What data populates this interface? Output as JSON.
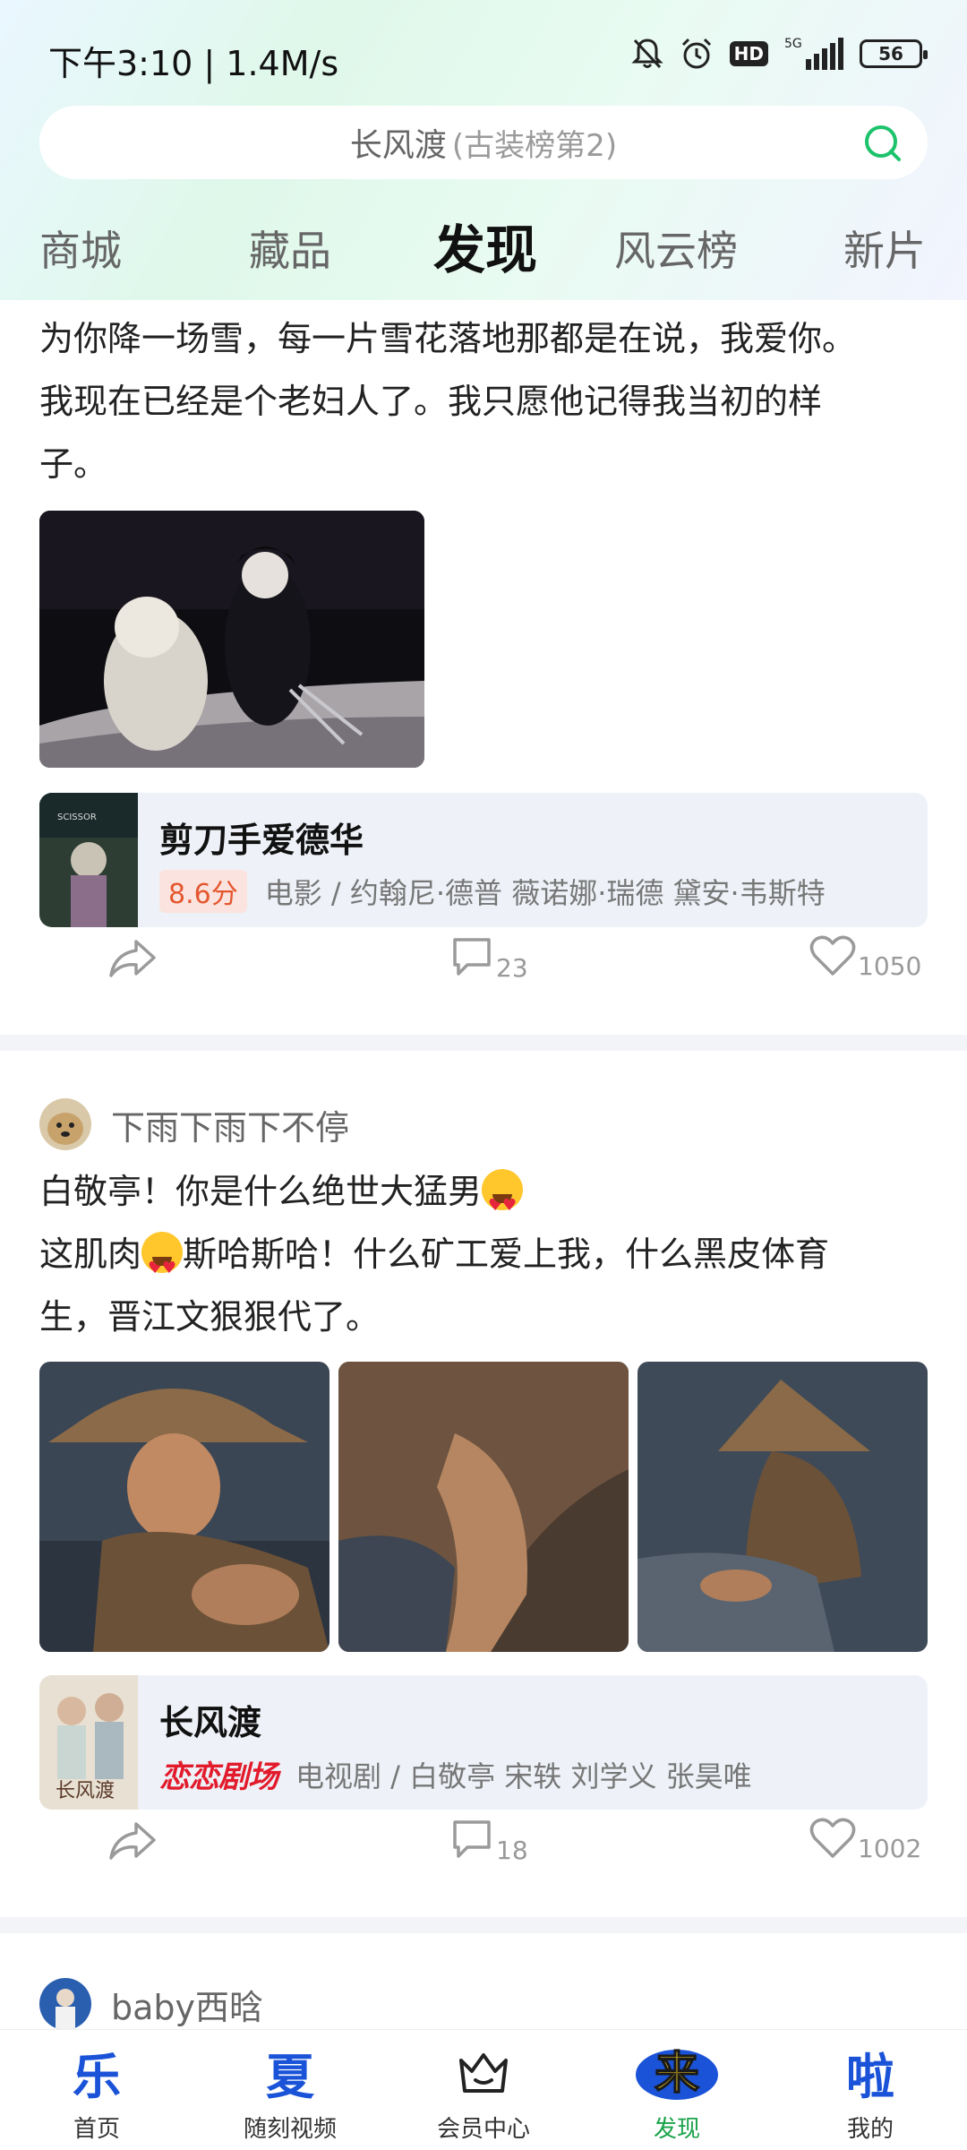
{
  "status": {
    "time": "下午3:10 | 1.4M/s",
    "network": "5G",
    "hd": "HD",
    "battery": "56"
  },
  "search": {
    "title": "长风渡",
    "subtitle": "(古装榜第2)"
  },
  "tabs": [
    {
      "label": "商城"
    },
    {
      "label": "藏品"
    },
    {
      "label": "发现",
      "active": true
    },
    {
      "label": "风云榜"
    },
    {
      "label": "新片"
    }
  ],
  "posts": [
    {
      "text_lines": [
        "为你降一场雪，每一片雪花落地那都是在说，我爱你。",
        "我现在已经是个老妇人了。我只愿他记得我当初的样",
        "子。"
      ],
      "media": {
        "title": "剪刀手爱德华",
        "score": "8.6分",
        "meta": "电影 / 约翰尼·德普 薇诺娜·瑞德 黛安·韦斯特"
      },
      "comments": "23",
      "likes": "1050"
    },
    {
      "user": "下雨下雨下不停",
      "line1": "白敬亭！你是什么绝世大猛男",
      "line2a": "这肌肉",
      "line2b": "斯哈斯哈！什么矿工爱上我，什么黑皮体育",
      "line3": "生，晋江文狠狠代了。",
      "media": {
        "title": "长风渡",
        "brand": "恋恋剧场",
        "meta": "电视剧 / 白敬亭 宋轶 刘学义 张昊唯"
      },
      "comments": "18",
      "likes": "1002"
    },
    {
      "user": "baby西晗"
    }
  ],
  "nav": [
    {
      "glyph": "乐",
      "label": "首页"
    },
    {
      "glyph": "夏",
      "label": "随刻视频"
    },
    {
      "glyph": "",
      "label": "会员中心"
    },
    {
      "glyph": "来",
      "label": "发现",
      "active": true
    },
    {
      "glyph": "啦",
      "label": "我的"
    }
  ],
  "colors": {
    "accent_green": "#1aa34a",
    "nav_blue": "#1a53d8",
    "score_red": "#e4572e",
    "brand_red": "#e21b2c"
  }
}
